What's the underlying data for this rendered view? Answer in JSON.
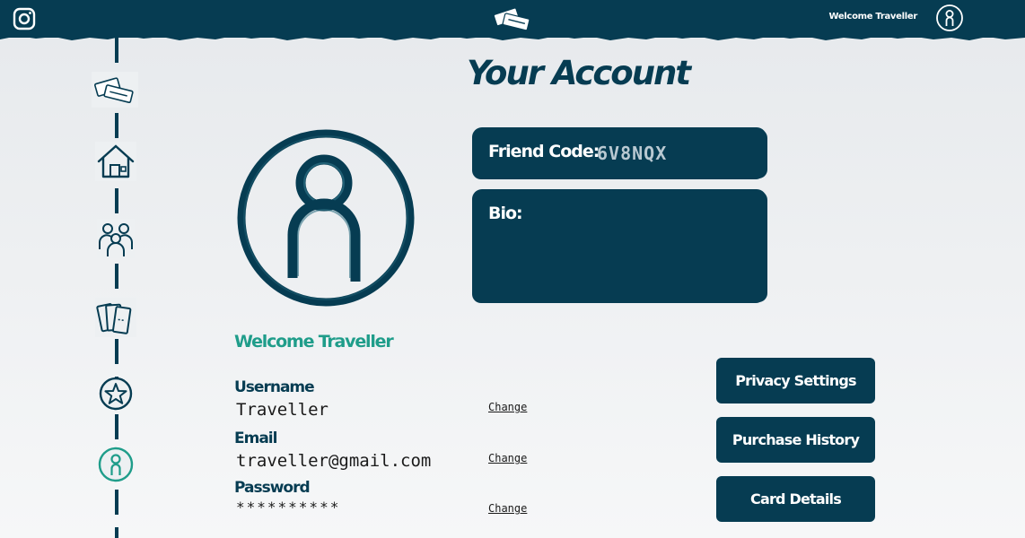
{
  "header": {
    "welcome_text": "Welcome Traveller",
    "icons": [
      "instagram-icon",
      "ticket-logo-icon",
      "user-avatar-icon"
    ]
  },
  "sidebar": {
    "items": [
      {
        "name": "ticket-logo",
        "icon": "ticket-logo-icon"
      },
      {
        "name": "home",
        "icon": "house-icon"
      },
      {
        "name": "friends",
        "icon": "people-icon"
      },
      {
        "name": "tickets",
        "icon": "tickets-icon"
      },
      {
        "name": "favourites",
        "icon": "star-icon"
      },
      {
        "name": "account",
        "icon": "user-icon",
        "active": true
      }
    ]
  },
  "main": {
    "title": "Your Account",
    "friend_code_label": "Friend Code:",
    "friend_code": "6V8NQX",
    "bio_label": "Bio:",
    "bio_text": "",
    "welcome": "Welcome Traveller",
    "fields": [
      {
        "label": "Username",
        "value": "Traveller",
        "action": "Change"
      },
      {
        "label": "Email",
        "value": "traveller@gmail.com",
        "action": "Change"
      },
      {
        "label": "Password",
        "value": "**********",
        "action": "Change"
      }
    ],
    "buttons": [
      "Privacy Settings",
      "Purchase History",
      "Card Details"
    ]
  },
  "colors": {
    "primary": "#063c52",
    "accent": "#1f9d8a",
    "background": "#eceff1",
    "friend_code": "#b9c9d2"
  }
}
